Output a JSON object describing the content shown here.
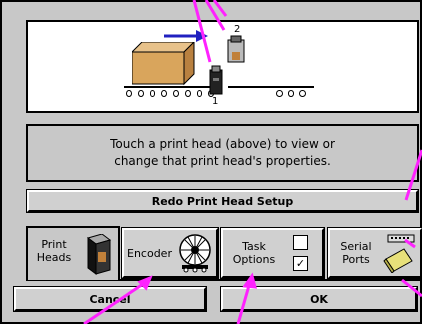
{
  "diagram": {
    "head1_label": "1",
    "head2_label": "2",
    "arrow_color": "#2020c0",
    "box_color": "#d9a55c"
  },
  "info": {
    "line1": "Touch a print head (above) to view or",
    "line2": "change that print head's properties."
  },
  "buttons": {
    "redo": "Redo Print Head Setup",
    "cancel": "Cancel",
    "ok": "OK"
  },
  "tabs": {
    "print_heads_line1": "Print",
    "print_heads_line2": "Heads",
    "encoder": "Encoder",
    "task_line1": "Task",
    "task_line2": "Options",
    "serial_line1": "Serial",
    "serial_line2": "Ports"
  },
  "checkboxes": {
    "top_checked": false,
    "bottom_checked": true,
    "bottom_mark": "☑"
  },
  "callout_color": "#ff22ff"
}
